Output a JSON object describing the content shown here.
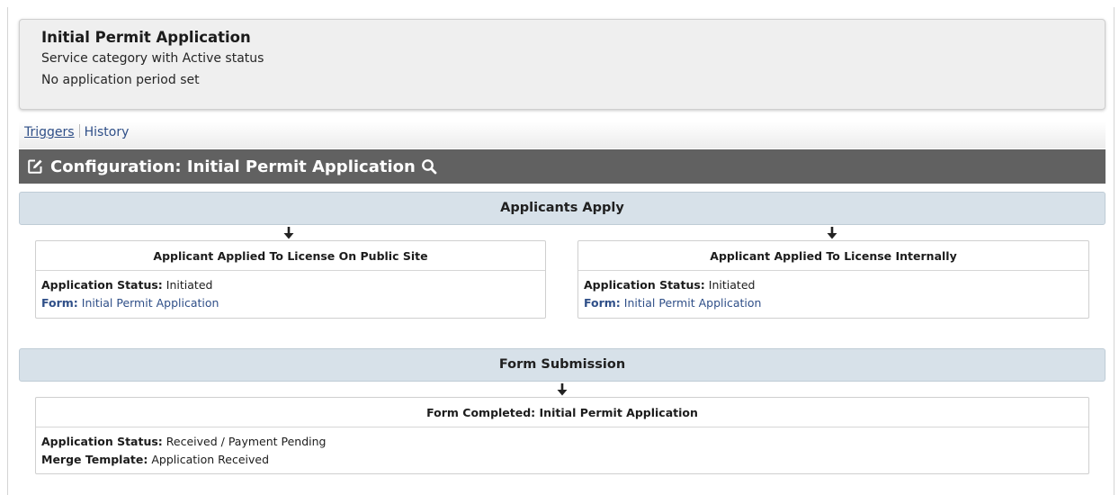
{
  "summary": {
    "title": "Initial Permit Application",
    "category_status": "Service category with Active status",
    "period": "No application period set"
  },
  "tabs": {
    "triggers": "Triggers",
    "history": "History"
  },
  "config": {
    "title": "Configuration: Initial Permit Application",
    "edit_icon": "edit-icon",
    "search_icon": "search-icon"
  },
  "stages": [
    {
      "title": "Applicants Apply",
      "triggers": [
        {
          "title": "Applicant Applied To License On Public Site",
          "status_label": "Application Status:",
          "status_value": "Initiated",
          "form_label": "Form:",
          "form_value": "Initial Permit Application"
        },
        {
          "title": "Applicant Applied To License Internally",
          "status_label": "Application Status:",
          "status_value": "Initiated",
          "form_label": "Form:",
          "form_value": "Initial Permit Application"
        }
      ]
    },
    {
      "title": "Form Submission",
      "triggers": [
        {
          "title": "Form Completed: Initial Permit Application",
          "status_label": "Application Status:",
          "status_value": "Received / Payment Pending",
          "merge_label": "Merge Template:",
          "merge_value": "Application Received"
        }
      ]
    }
  ],
  "colors": {
    "config_bar": "#616161",
    "stage_header": "#d7e1e9",
    "link": "#2f4f88"
  }
}
